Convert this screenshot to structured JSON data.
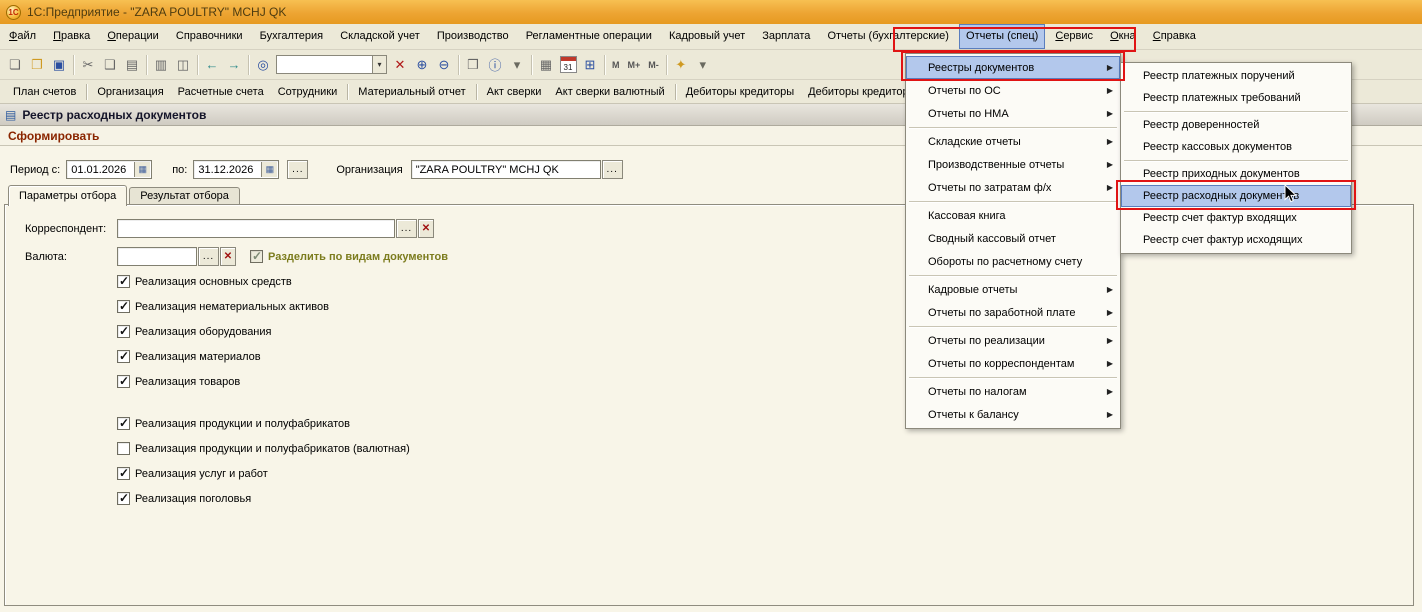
{
  "titlebar": {
    "app_icon_text": "1С",
    "title": "1С:Предприятие - \"ZARA POULTRY\" MCHJ QK"
  },
  "icons": {
    "new_doc": "❏",
    "open_folder": "❐",
    "save": "▣",
    "cut": "✂",
    "copy": "❑",
    "paste": "▤",
    "print": "▥",
    "print_preview": "◫",
    "back": "←",
    "forward": "→",
    "find": "◎",
    "dropdown": "▾",
    "clear": "✕",
    "find_forward": "⊕",
    "find_backward": "⊖",
    "copy_format": "❒",
    "info": "ⓘ",
    "table": "▦",
    "calculator": "⊞",
    "key": "✦",
    "submenu_arrow": "▶",
    "date_picker": "▦",
    "report_window": "▤",
    "dots": "..."
  },
  "menubar": {
    "items": [
      {
        "label": "Файл"
      },
      {
        "label": "Правка"
      },
      {
        "label": "Операции"
      },
      {
        "label": "Справочники"
      },
      {
        "label": "Бухгалтерия"
      },
      {
        "label": "Складской учет"
      },
      {
        "label": "Производство"
      },
      {
        "label": "Регламентные операции"
      },
      {
        "label": "Кадровый учет"
      },
      {
        "label": "Зарплата"
      },
      {
        "label": "Отчеты (бухгалтерские)"
      },
      {
        "label": "Отчеты (спец)",
        "selected": true
      },
      {
        "label": "Сервис"
      },
      {
        "label": "Окна"
      },
      {
        "label": "Справка"
      }
    ]
  },
  "toolbar": {
    "search_value": "",
    "calendar_label": "31",
    "memory": [
      "M",
      "M+",
      "M-"
    ]
  },
  "quickbar": {
    "buttons": [
      "План счетов",
      "Организация",
      "Расчетные счета",
      "Сотрудники",
      "Материальный отчет",
      "Акт сверки",
      "Акт сверки валютный",
      "Дебиторы кредиторы",
      "Дебиторы кредиторы (вал"
    ]
  },
  "report": {
    "window_title": "Реестр расходных документов",
    "action_label": "Сформировать",
    "period_from_label": "Период с:",
    "period_from": "01.01.2026",
    "period_to_label": "по:",
    "period_to": "31.12.2026",
    "org_label": "Организация",
    "org_value": "\"ZARA POULTRY\" MCHJ QK",
    "tabs": [
      {
        "label": "Параметры отбора",
        "active": true
      },
      {
        "label": "Результат отбора",
        "active": false
      }
    ],
    "correspondent_label": "Корреспондент:",
    "correspondent_value": "",
    "currency_label": "Валюта:",
    "currency_value": "",
    "split_by_type": {
      "label": "Разделить по видам документов",
      "checked": true,
      "disabled": true
    },
    "filters": [
      {
        "label": "Реализация основных средств",
        "checked": true
      },
      {
        "label": "Реализация нематериальных активов",
        "checked": true
      },
      {
        "label": "Реализация оборудования",
        "checked": true
      },
      {
        "label": "Реализация материалов",
        "checked": true
      },
      {
        "label": "Реализация товаров",
        "checked": true
      },
      {
        "label": "Реализация продукции и полуфабрикатов",
        "checked": true
      },
      {
        "label": "Реализация продукции и полуфабрикатов (валютная)",
        "checked": false
      },
      {
        "label": "Реализация услуг и работ",
        "checked": true
      },
      {
        "label": "Реализация поголовья",
        "checked": true
      }
    ]
  },
  "spec_menu": {
    "items": [
      {
        "label": "Реестры документов",
        "has_submenu": true,
        "selected": true
      },
      {
        "label": "Отчеты по ОС",
        "has_submenu": true
      },
      {
        "label": "Отчеты по НМА",
        "has_submenu": true
      },
      {
        "label": "Складские отчеты",
        "has_submenu": true
      },
      {
        "label": "Производственные отчеты",
        "has_submenu": true
      },
      {
        "label": "Отчеты по затратам ф/х",
        "has_submenu": true
      },
      {
        "label": "Кассовая книга"
      },
      {
        "label": "Сводный кассовый отчет"
      },
      {
        "label": "Обороты по расчетному счету"
      },
      {
        "label": "Кадровые отчеты",
        "has_submenu": true
      },
      {
        "label": "Отчеты по заработной плате",
        "has_submenu": true
      },
      {
        "label": "Отчеты по реализации",
        "has_submenu": true
      },
      {
        "label": "Отчеты по корреспондентам",
        "has_submenu": true
      },
      {
        "label": "Отчеты по налогам",
        "has_submenu": true
      },
      {
        "label": "Отчеты к балансу",
        "has_submenu": true
      }
    ]
  },
  "registry_submenu": {
    "items": [
      {
        "label": "Реестр платежных поручений"
      },
      {
        "label": "Реестр платежных требований"
      },
      {
        "label": "Реестр доверенностей"
      },
      {
        "label": "Реестр кассовых документов"
      },
      {
        "label": "Реестр приходных документов"
      },
      {
        "label": "Реестр расходных документов",
        "selected": true
      },
      {
        "label": "Реестр счет фактур входящих"
      },
      {
        "label": "Реестр счет фактур исходящих"
      }
    ]
  }
}
